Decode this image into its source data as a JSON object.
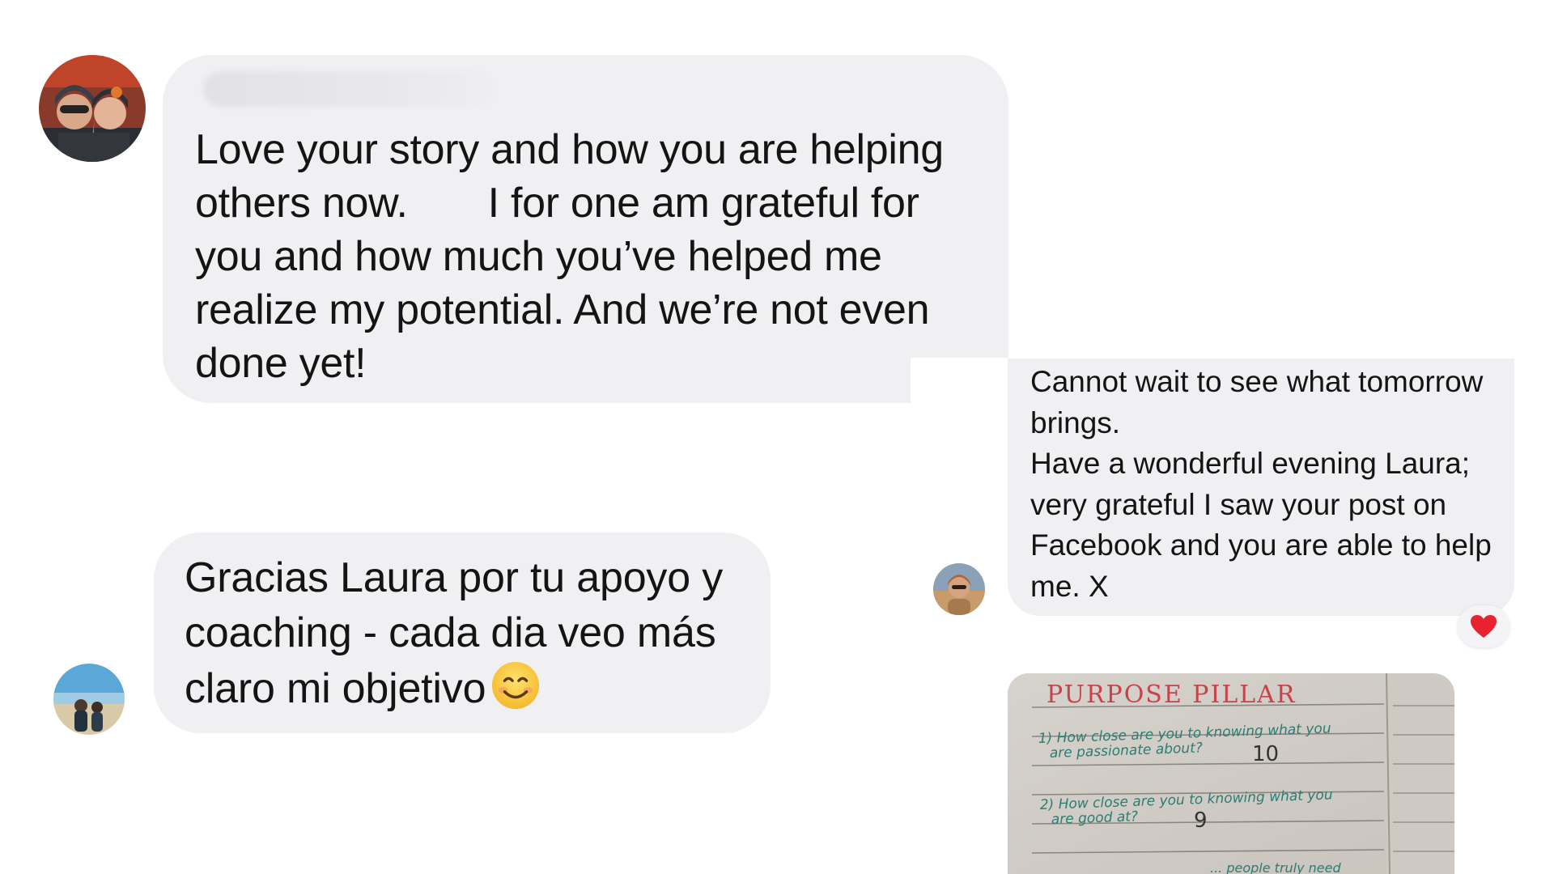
{
  "messages": [
    {
      "text": "Love your story and how you are helping\nothers now.       I for one am grateful for\nyou and how much you’ve helped me\nrealize my potential. And we’re not even\ndone yet!"
    },
    {
      "text": "Gracias Laura por tu apoyo y coaching - cada dia veo más claro mi objetivo",
      "emoji": "smiling-face-icon"
    },
    {
      "text": "Cannot wait to see what tomorrow brings.\nHave a wonderful evening Laura; very grateful I saw your post on Facebook and you are able to help me. X",
      "reaction": "heart-icon"
    }
  ],
  "notebook": {
    "title": "PURPOSE PILLAR",
    "q1_line1": "1) How close are you to knowing what you",
    "q1_line2": "are passionate about?",
    "q1_answer": "10",
    "q2_line1": "2) How close are you to knowing what you",
    "q2_line2": "are good at?",
    "q2_answer": "9",
    "q3_partial": "... people truly need"
  },
  "colors": {
    "bubble": "#f0f0f3",
    "text": "#141414",
    "reaction_heart": "#e8222e",
    "handwriting": "#2b7d73",
    "handwriting_title": "#c8424c"
  }
}
